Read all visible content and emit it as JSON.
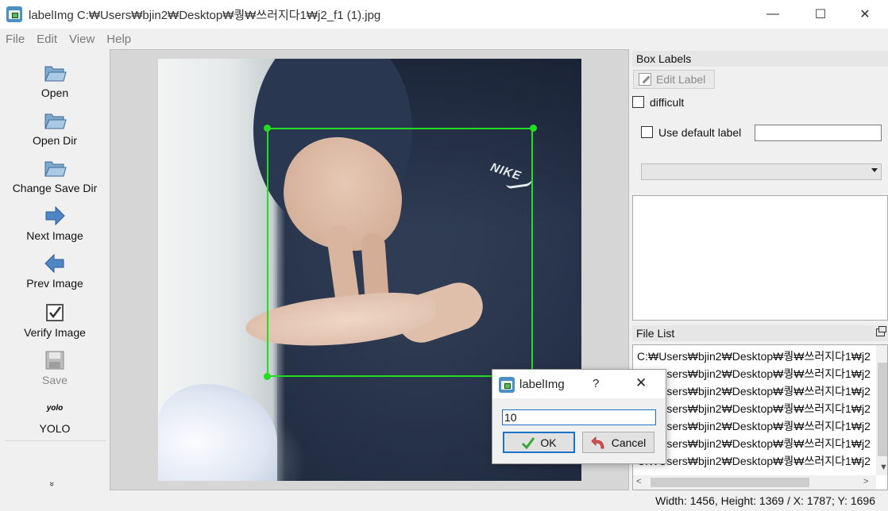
{
  "window": {
    "title": "labelImg C:₩Users₩bjin2₩Desktop₩퀑₩쓰러지다1₩j2_f1 (1).jpg",
    "minimize_glyph": "—",
    "maximize_glyph": "☐",
    "close_glyph": "✕"
  },
  "menu": [
    "File",
    "Edit",
    "View",
    "Help"
  ],
  "toolbar": {
    "items": [
      {
        "label": "Open",
        "icon": "folder-open-icon"
      },
      {
        "label": "Open Dir",
        "icon": "folder-open-icon"
      },
      {
        "label": "Change Save Dir",
        "icon": "folder-open-icon"
      },
      {
        "label": "Next Image",
        "icon": "arrow-right-icon"
      },
      {
        "label": "Prev Image",
        "icon": "arrow-left-icon"
      },
      {
        "label": "Verify Image",
        "icon": "checkbox-icon"
      },
      {
        "label": "Save",
        "icon": "floppy-disk-icon",
        "disabled": true
      },
      {
        "label": "YOLO",
        "icon_text": "yolo"
      }
    ],
    "more_glyph": "»"
  },
  "canvas": {
    "image_logo_text": "NIKE"
  },
  "box_labels": {
    "title": "Box Labels",
    "edit_label_button": "Edit Label",
    "difficult_label": "difficult",
    "use_default_label": "Use default label",
    "default_label_value": ""
  },
  "file_list": {
    "title": "File List",
    "rows": [
      "C:₩Users₩bjin2₩Desktop₩퀑₩쓰러지다1₩j2",
      "C:₩Users₩bjin2₩Desktop₩퀑₩쓰러지다1₩j2",
      "C:₩Users₩bjin2₩Desktop₩퀑₩쓰러지다1₩j2",
      "C:₩Users₩bjin2₩Desktop₩퀑₩쓰러지다1₩j2",
      "C:₩Users₩bjin2₩Desktop₩퀑₩쓰러지다1₩j2",
      "C:₩Users₩bjin2₩Desktop₩퀑₩쓰러지다1₩j2",
      "C:₩Users₩bjin2₩Desktop₩퀑₩쓰러지다1₩j2"
    ]
  },
  "status": {
    "text": "Width: 1456, Height: 1369 / X: 1787; Y: 1696"
  },
  "dialog": {
    "title": "labelImg",
    "help_glyph": "?",
    "close_glyph": "✕",
    "input_value": "10",
    "ok_label": "OK",
    "cancel_label": "Cancel"
  },
  "colors": {
    "bbox": "#22dd22",
    "accent": "#1a73c8"
  }
}
